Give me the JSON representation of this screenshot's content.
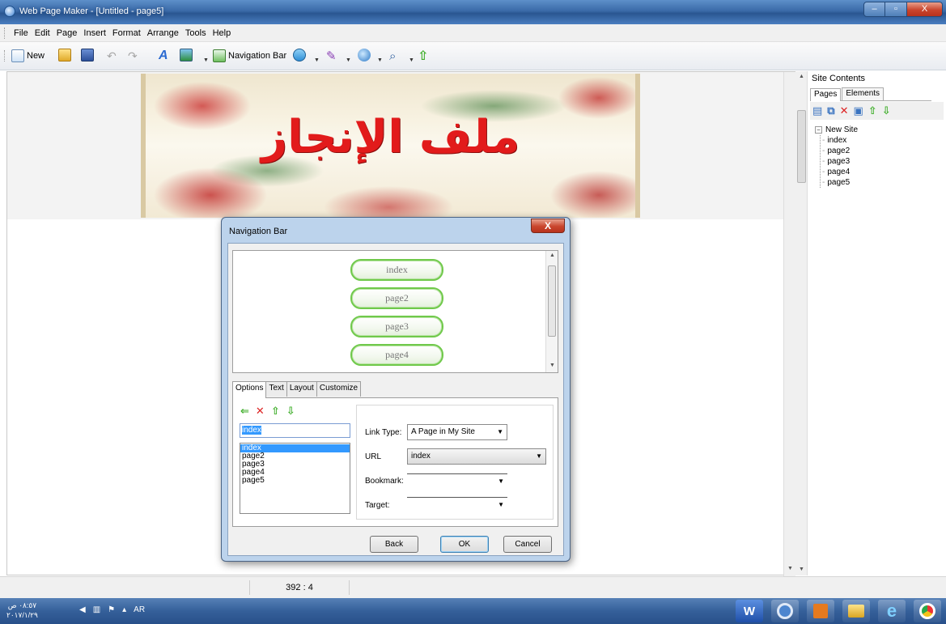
{
  "window": {
    "title": "Web Page Maker - [Untitled - page5]",
    "buttons": {
      "minimize": "–",
      "maximize": "▫",
      "close": "X"
    }
  },
  "menu": [
    "File",
    "Edit",
    "Page",
    "Insert",
    "Format",
    "Arrange",
    "Tools",
    "Help"
  ],
  "toolbar": {
    "new_label": "New",
    "navigation_bar_label": "Navigation Bar"
  },
  "banner": {
    "title": "ملف الإنجاز"
  },
  "site_contents": {
    "title": "Site Contents",
    "tabs": [
      "Pages",
      "Elements"
    ],
    "tree_root": "New Site",
    "pages": [
      "index",
      "page2",
      "page3",
      "page4",
      "page5"
    ]
  },
  "status": {
    "position": "392 : 4"
  },
  "taskbar": {
    "clock_time": "٠٨:٥٧ ص",
    "clock_date": "٢٠١٧/١/٢٩",
    "lang": "AR"
  },
  "dialog": {
    "title": "Navigation Bar",
    "preview_buttons": [
      "index",
      "page2",
      "page3",
      "page4"
    ],
    "tabs": [
      "Options",
      "Text",
      "Layout",
      "Customize"
    ],
    "name_value": "index",
    "pages": [
      "index",
      "page2",
      "page3",
      "page4",
      "page5"
    ],
    "link_type_label": "Link Type:",
    "link_type_value": "A Page in My Site",
    "url_label": "URL",
    "url_value": "index",
    "bookmark_label": "Bookmark:",
    "bookmark_value": "",
    "target_label": "Target:",
    "target_value": "",
    "back_label": "Back",
    "ok_label": "OK",
    "cancel_label": "Cancel",
    "close_label": "X"
  },
  "colors": {
    "titlebar": "#3a6aa8",
    "banner_text": "#e21b1b",
    "nav_button_border": "#70c94b",
    "selection": "#3399ff"
  }
}
